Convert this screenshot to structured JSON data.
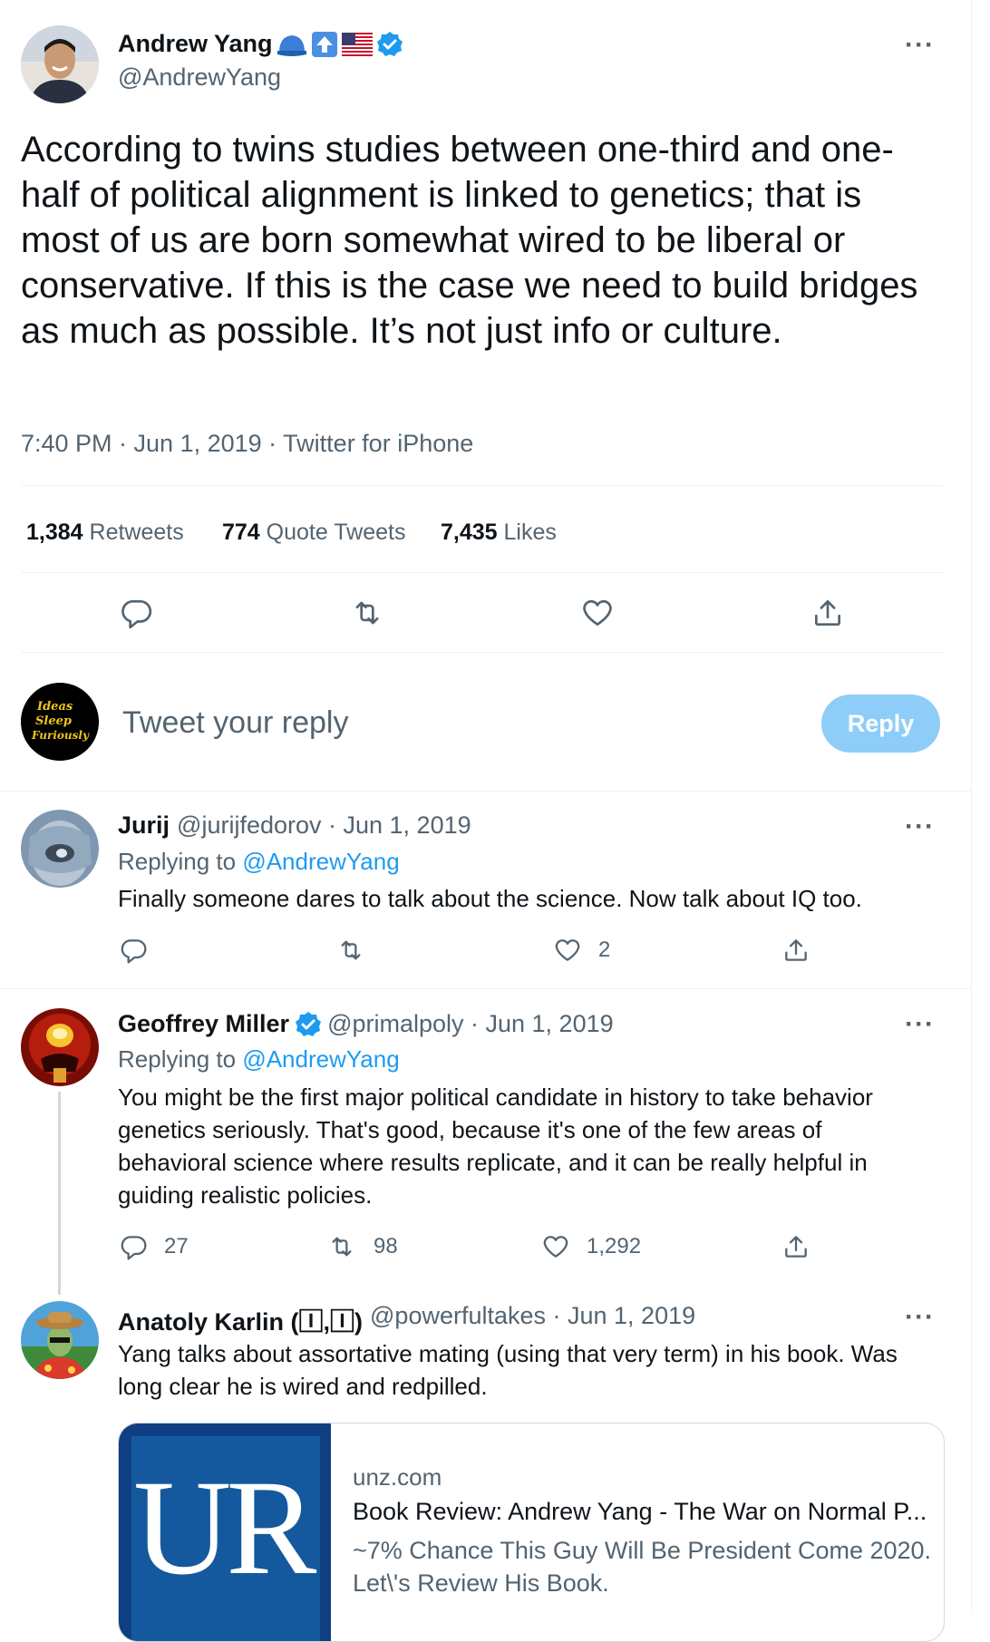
{
  "main_tweet": {
    "author_name": "Andrew Yang",
    "author_handle": "@AndrewYang",
    "name_icons": [
      "hat-icon",
      "arrow-up-icon",
      "us-flag-icon",
      "verified-badge-icon"
    ],
    "text": "According to twins studies between one-third and one-half of political alignment is linked to genetics; that is most of us are born somewhat wired to be liberal or conservative. If this is the case we need to build bridges as much as possible. It’s not just info or culture.",
    "time": "7:40 PM · Jun 1, 2019 · Twitter for iPhone",
    "stats": {
      "retweets_count": "1,384",
      "retweets_label": "Retweets",
      "quotes_count": "774",
      "quotes_label": "Quote Tweets",
      "likes_count": "7,435",
      "likes_label": "Likes"
    },
    "more": "···"
  },
  "compose": {
    "avatar_text": [
      "Ideas",
      "Sleep",
      "Furiously"
    ],
    "placeholder": "Tweet your reply",
    "button": "Reply"
  },
  "replies": [
    {
      "name": "Jurij",
      "handle": "@jurijfedorov · Jun 1, 2019",
      "replying_prefix": "Replying to",
      "replying_to": "@AndrewYang",
      "text": "Finally someone dares to talk about the science. Now talk about IQ too.",
      "reply_count": "",
      "retweet_count": "",
      "like_count": "2",
      "more": "···"
    },
    {
      "name": "Geoffrey Miller",
      "handle": "@primalpoly · Jun 1, 2019",
      "verified": true,
      "replying_prefix": "Replying to",
      "replying_to": "@AndrewYang",
      "text": "You might be the first major political candidate in history to take behavior genetics seriously. That's good, because it's one of the few areas of behavioral science where results replicate, and it can be really helpful in guiding realistic policies.",
      "reply_count": "27",
      "retweet_count": "98",
      "like_count": "1,292",
      "more": "···"
    },
    {
      "name": "Anatoly Karlin (🄸,🄸)",
      "handle": "@powerfultakes · Jun 1, 2019",
      "text": "Yang talks about assortative mating (using that very term) in his book. Was long clear he is wired and redpilled.",
      "more": "···",
      "card": {
        "logo": "UR",
        "domain": "unz.com",
        "title": "Book Review: Andrew Yang - The War on Normal P...",
        "description": "~7% Chance This Guy Will Be President Come 2020. Let\\'s Review His Book."
      }
    }
  ],
  "colors": {
    "accent": "#1d9bf0",
    "reply_button": "#8ecdf8",
    "text": "#0f1419",
    "secondary": "#536471",
    "border": "#eff3f4"
  }
}
